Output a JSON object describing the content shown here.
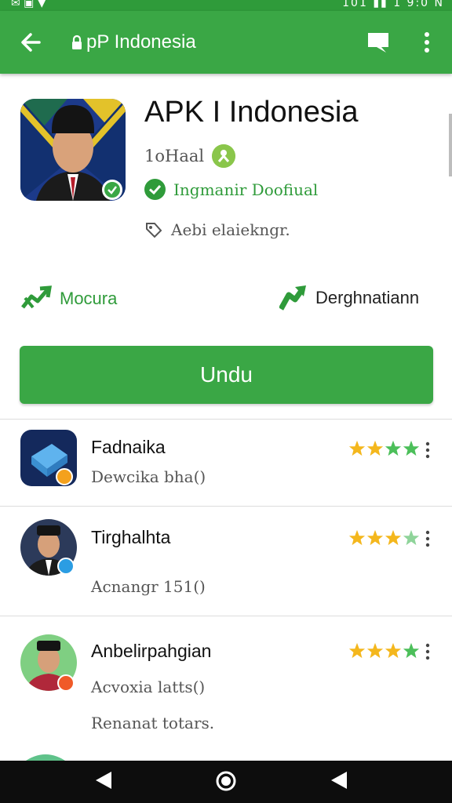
{
  "status": {
    "time": "1 9:0 N",
    "signal": "101"
  },
  "app_bar": {
    "title": "pP Indonesia"
  },
  "app": {
    "name": "APK I Indonesia",
    "developer": "1oHaal",
    "verified_label": "Ingmanir Doofiual",
    "age_label": "Aebi elaiekngr.",
    "action_left": "Mocura",
    "action_right": "Derghnatiann",
    "download_label": "Undu"
  },
  "list": [
    {
      "title": "Fadnaika",
      "subtitle": "Dewcika bha()",
      "rating": 4,
      "icon": "package-icon",
      "badge_color": "#f4a11d"
    },
    {
      "title": "Tirghalhta",
      "subtitle": "Acnangr 151()",
      "rating": 3.5,
      "icon": "avatar-man-icon",
      "badge_color": "#2b9de3"
    },
    {
      "title": "Anbelirpahgian",
      "subtitle": "Acvoxia latts()",
      "rating": 3.5,
      "icon": "avatar-man-green-icon",
      "badge_color": "#f05a28",
      "extra": "Renanat totars."
    }
  ],
  "colors": {
    "primary": "#3aa745",
    "primary_dark": "#2f9b3a",
    "star": "#f4b71d",
    "star_green": "#4cbf5a"
  }
}
